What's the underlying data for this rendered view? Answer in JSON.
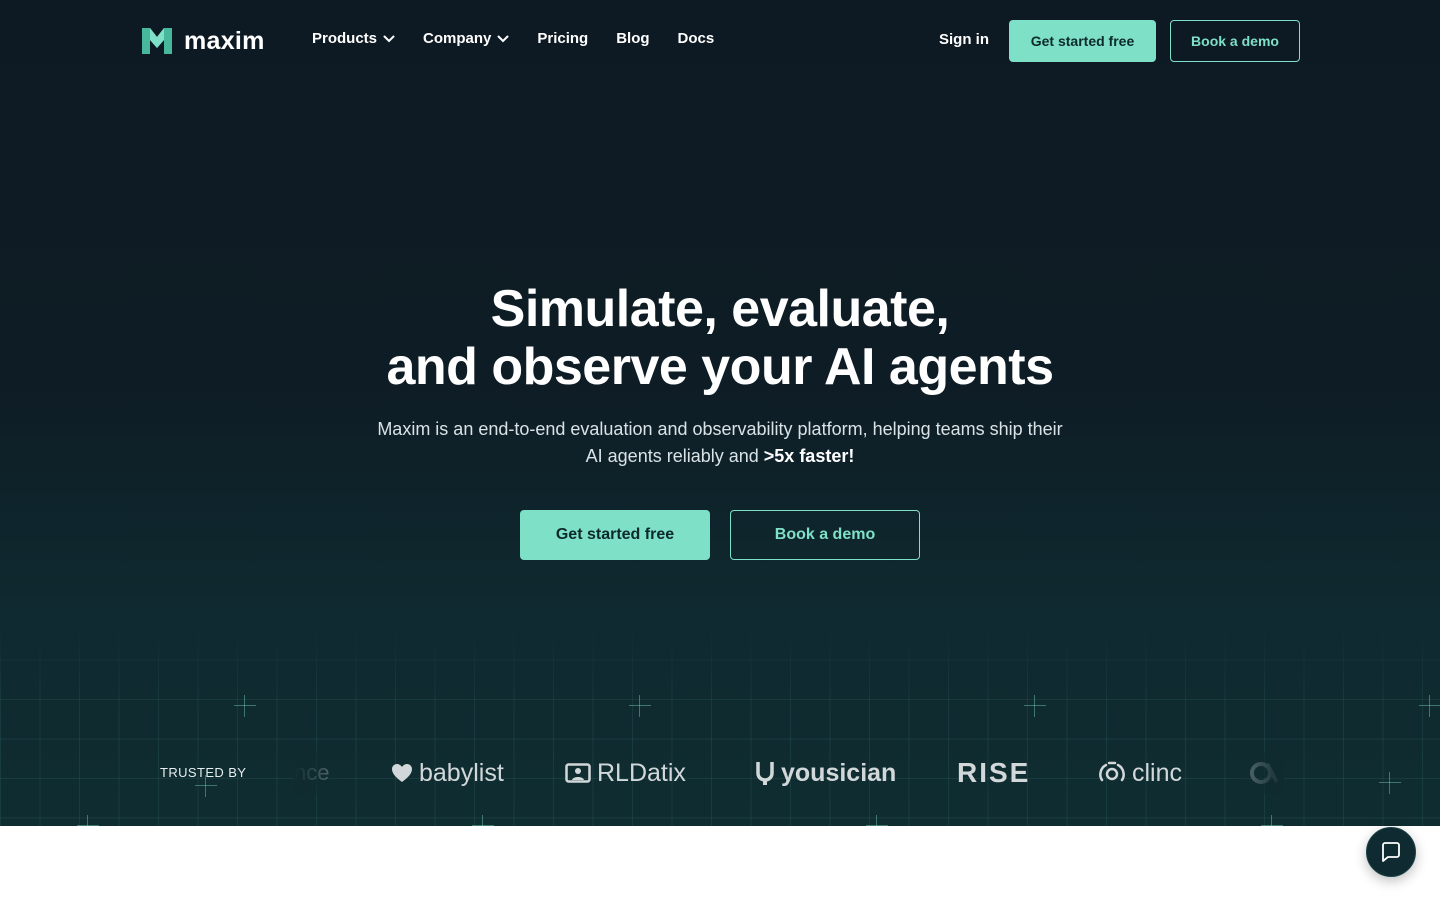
{
  "nav": {
    "brand": "maxim",
    "links": [
      {
        "label": "Products",
        "has_dropdown": true
      },
      {
        "label": "Company",
        "has_dropdown": true
      },
      {
        "label": "Pricing",
        "has_dropdown": false
      },
      {
        "label": "Blog",
        "has_dropdown": false
      },
      {
        "label": "Docs",
        "has_dropdown": false
      }
    ],
    "sign_in": "Sign in",
    "get_started": "Get started free",
    "book_demo": "Book a demo"
  },
  "hero": {
    "headline_line1": "Simulate, evaluate,",
    "headline_line2": "and observe your AI agents",
    "subtitle_start": "Maxim is an end-to-end evaluation and observability platform, helping teams ship their AI agents reliably and",
    "subtitle_emphasis": ">5x faster!",
    "cta_primary": "Get started free",
    "cta_secondary": "Book a demo"
  },
  "trusted": {
    "label": "TRUSTED BY",
    "logos": [
      "nce",
      "babylist",
      "RLDatix",
      "yousician",
      "RISE",
      "clinc"
    ]
  },
  "colors": {
    "background": "#0e1a23",
    "accent": "#7ee0c6",
    "text": "#ffffff"
  },
  "icons": {
    "chat": "chat-bubble-icon",
    "dropdown": "chevron-down-icon"
  }
}
